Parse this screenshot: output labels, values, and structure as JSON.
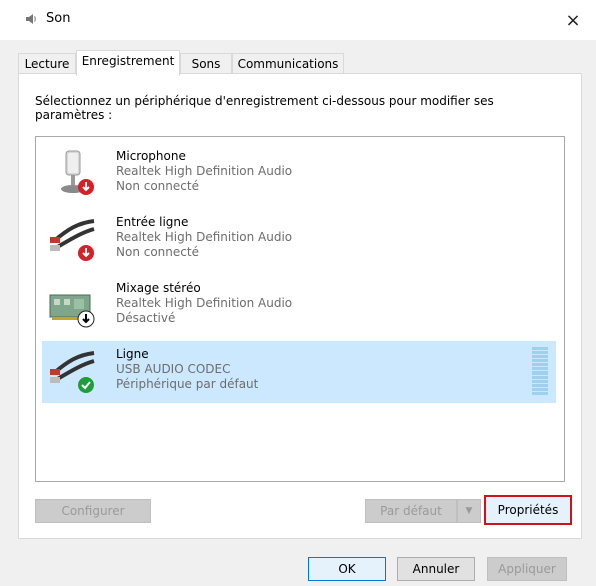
{
  "window": {
    "title": "Son",
    "close_glyph": "×"
  },
  "tabs": [
    {
      "label": "Lecture",
      "active": false
    },
    {
      "label": "Enregistrement",
      "active": true
    },
    {
      "label": "Sons",
      "active": false
    },
    {
      "label": "Communications",
      "active": false
    }
  ],
  "instruction": "Sélectionnez un périphérique d'enregistrement ci-dessous pour modifier ses paramètres :",
  "devices": [
    {
      "name": "Microphone",
      "driver": "Realtek High Definition Audio",
      "status": "Non connecté",
      "icon": "microphone-icon",
      "badge": "red-down-arrow"
    },
    {
      "name": "Entrée ligne",
      "driver": "Realtek High Definition Audio",
      "status": "Non connecté",
      "icon": "line-in-cable-icon",
      "badge": "red-down-arrow"
    },
    {
      "name": "Mixage stéréo",
      "driver": "Realtek High Definition Audio",
      "status": "Désactivé",
      "icon": "sound-card-icon",
      "badge": "black-down-arrow"
    },
    {
      "name": "Ligne",
      "driver": "USB AUDIO  CODEC",
      "status": "Périphérique par défaut",
      "icon": "line-cable-icon",
      "badge": "green-check",
      "selected": true
    }
  ],
  "buttons": {
    "configure": "Configurer",
    "set_default": "Par défaut",
    "properties": "Propriétés",
    "ok": "OK",
    "cancel": "Annuler",
    "apply": "Appliquer"
  },
  "colors": {
    "selection": "#cce8ff",
    "annotation": "#d0121b",
    "level": "#9fd0ef"
  }
}
